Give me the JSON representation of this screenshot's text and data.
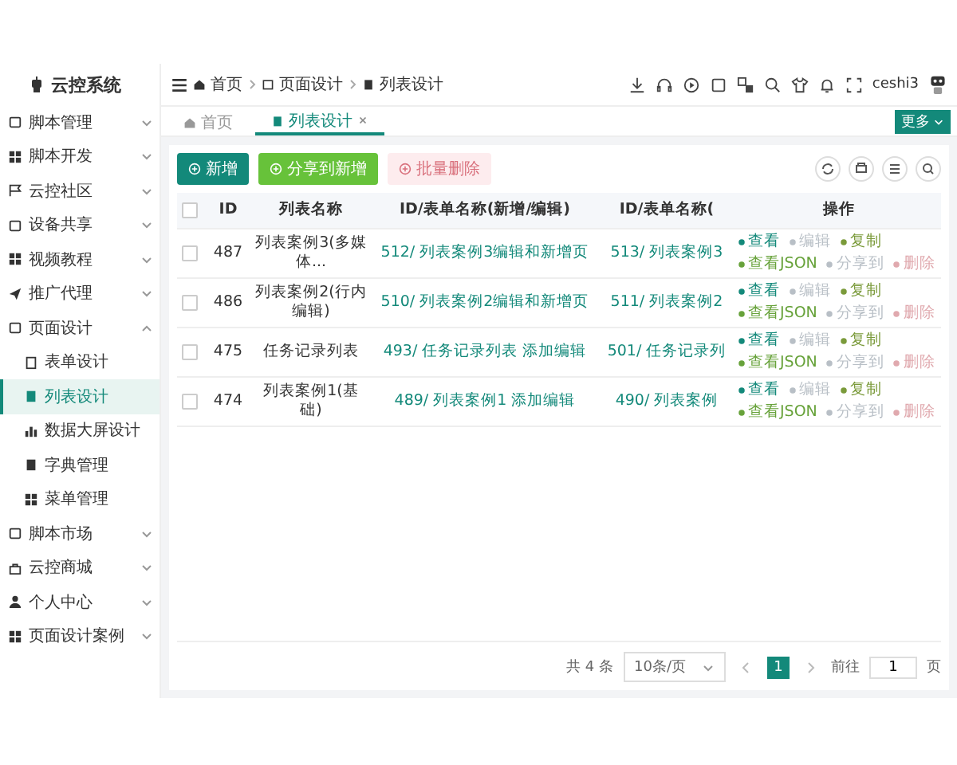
{
  "sidebar": {
    "title": "云控系统",
    "items": [
      {
        "label": "脚本管理",
        "expanded": false
      },
      {
        "label": "脚本开发",
        "expanded": false
      },
      {
        "label": "云控社区",
        "expanded": false
      },
      {
        "label": "设备共享",
        "expanded": false
      },
      {
        "label": "视频教程",
        "expanded": false
      },
      {
        "label": "推广代理",
        "expanded": false
      },
      {
        "label": "页面设计",
        "expanded": true,
        "children": [
          {
            "label": "表单设计",
            "selected": false
          },
          {
            "label": "列表设计",
            "selected": true
          },
          {
            "label": "数据大屏设计",
            "selected": false
          },
          {
            "label": "字典管理",
            "selected": false
          },
          {
            "label": "菜单管理",
            "selected": false
          }
        ]
      },
      {
        "label": "脚本市场",
        "expanded": false
      },
      {
        "label": "云控商城",
        "expanded": false
      },
      {
        "label": "个人中心",
        "expanded": false
      },
      {
        "label": "页面设计案例",
        "expanded": false
      }
    ]
  },
  "header": {
    "breadcrumb": [
      "首页",
      "页面设计",
      "列表设计"
    ],
    "user": "ceshi3"
  },
  "tabs": [
    {
      "label": "首页",
      "selected": false
    },
    {
      "label": "列表设计",
      "selected": true
    }
  ],
  "more_button": "更多",
  "toolbar": {
    "buttons": [
      {
        "label": "新增",
        "kind": "primary",
        "disabled": false
      },
      {
        "label": "分享到新增",
        "kind": "success",
        "disabled": false
      },
      {
        "label": "批量删除",
        "kind": "danger",
        "disabled": true
      }
    ]
  },
  "table": {
    "columns": [
      "ID",
      "列表名称",
      "ID/表单名称(新增/编辑)",
      "ID/表单名称(",
      "操作"
    ],
    "all_selected": false,
    "rows": [
      {
        "selected": false,
        "cells": [
          "487",
          "列表案例3(多媒体...",
          "512/ 列表案例3编辑和新增页",
          "513/ 列表案例3"
        ],
        "actions": [
          {
            "label": "查看",
            "kind": "view"
          },
          {
            "label": "编辑",
            "kind": "muted"
          },
          {
            "label": "复制",
            "kind": "copy"
          },
          {
            "label": "查看JSON",
            "kind": "json"
          },
          {
            "label": "分享到",
            "kind": "muted"
          },
          {
            "label": "删除",
            "kind": "danger"
          }
        ]
      },
      {
        "selected": false,
        "cells": [
          "486",
          "列表案例2(行内编辑)",
          "510/ 列表案例2编辑和新增页",
          "511/ 列表案例2"
        ],
        "actions": [
          {
            "label": "查看",
            "kind": "view"
          },
          {
            "label": "编辑",
            "kind": "muted"
          },
          {
            "label": "复制",
            "kind": "copy"
          },
          {
            "label": "查看JSON",
            "kind": "json"
          },
          {
            "label": "分享到",
            "kind": "muted"
          },
          {
            "label": "删除",
            "kind": "danger"
          }
        ]
      },
      {
        "selected": false,
        "cells": [
          "475",
          "任务记录列表",
          "493/ 任务记录列表 添加编辑",
          "501/ 任务记录列"
        ],
        "actions": [
          {
            "label": "查看",
            "kind": "view"
          },
          {
            "label": "编辑",
            "kind": "muted"
          },
          {
            "label": "复制",
            "kind": "copy"
          },
          {
            "label": "查看JSON",
            "kind": "json"
          },
          {
            "label": "分享到",
            "kind": "muted"
          },
          {
            "label": "删除",
            "kind": "danger"
          }
        ]
      },
      {
        "selected": false,
        "cells": [
          "474",
          "列表案例1(基础)",
          "489/ 列表案例1 添加编辑",
          "490/ 列表案例"
        ],
        "actions": [
          {
            "label": "查看",
            "kind": "view"
          },
          {
            "label": "编辑",
            "kind": "muted"
          },
          {
            "label": "复制",
            "kind": "copy"
          },
          {
            "label": "查看JSON",
            "kind": "json"
          },
          {
            "label": "分享到",
            "kind": "muted"
          },
          {
            "label": "删除",
            "kind": "danger"
          }
        ]
      }
    ]
  },
  "pagination": {
    "total": "共 4 条",
    "page_size": "10条/页",
    "pages": [
      {
        "label": "1",
        "selected": true
      }
    ],
    "goto_label": "前往",
    "goto_value": "1",
    "suffix": "页"
  }
}
